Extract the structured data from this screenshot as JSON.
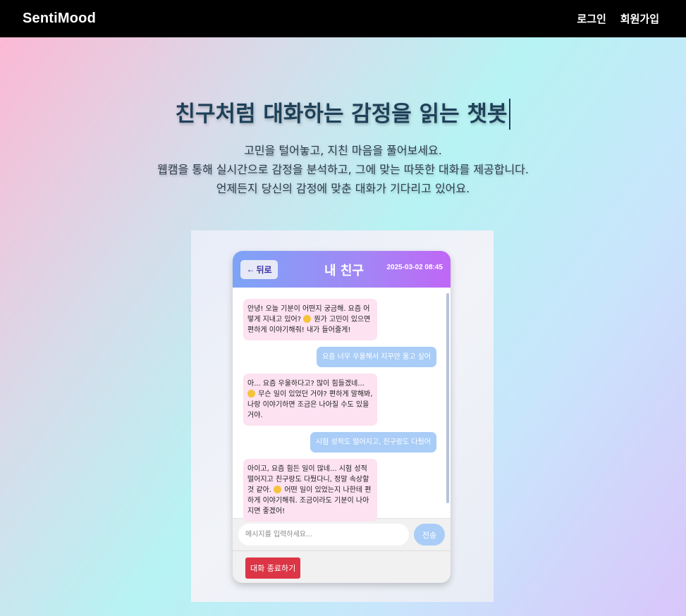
{
  "navbar": {
    "brand": "SentiMood",
    "login": "로그인",
    "signup": "회원가입"
  },
  "hero": {
    "title": "친구처럼 대화하는 감정을 읽는 챗봇",
    "lines": [
      "고민을 털어놓고, 지친 마음을 풀어보세요.",
      "웹캠을 통해 실시간으로 감정을 분석하고, 그에 맞는 따뜻한 대화를 제공합니다.",
      "언제든지 당신의 감정에 맞춘 대화가 기다리고 있어요."
    ]
  },
  "chat": {
    "back_label": "뒤로",
    "back_icon": "left-arrow-icon",
    "title": "내 친구",
    "timestamp": "2025-03-02 08:45",
    "messages": [
      {
        "sender": "bot",
        "pre": "안녕! 오늘 기분이 어떤지 궁금해. 요즘 어떻게 지내고 있어? ",
        "emoji": "smile-emoji",
        "post": " 뭔가 고민이 있으면 편하게 이야기해줘! 내가 들어줄게!"
      },
      {
        "sender": "user",
        "text": "요즘 너무 우울해서 지꾸만 울고 싶어"
      },
      {
        "sender": "bot",
        "pre": "아... 요즘 우울하다고? 많이 힘들겠네... ",
        "emoji": "sad-emoji",
        "post": " 무슨 일이 있었던 거야? 편하게 말해봐, 나랑 이야기하면 조금은 나아질 수도 있을 거야."
      },
      {
        "sender": "user",
        "text": "시험 성적도 떨어지고, 친구랑도 다퉜어"
      },
      {
        "sender": "bot",
        "pre": "아이고, 요즘 힘든 일이 많네... 시험 성적 떨어지고 친구랑도 다퉜다니, 정말 속상할 것 같아. ",
        "emoji": "sad-emoji",
        "post": " 어떤 일이 있었는지 나한테 편하게 이야기해줘. 조금이라도 기분이 나아지면 좋겠어!"
      }
    ],
    "input_placeholder": "메시지를 입력하세요...",
    "send_label": "전송",
    "end_label": "대화 종료하기"
  },
  "colors": {
    "navbar": "#000000",
    "title": "#1e4059",
    "bot_bubble": "#fde2f1",
    "user_bubble": "#a9cdf7",
    "end_button": "#dc3545"
  }
}
